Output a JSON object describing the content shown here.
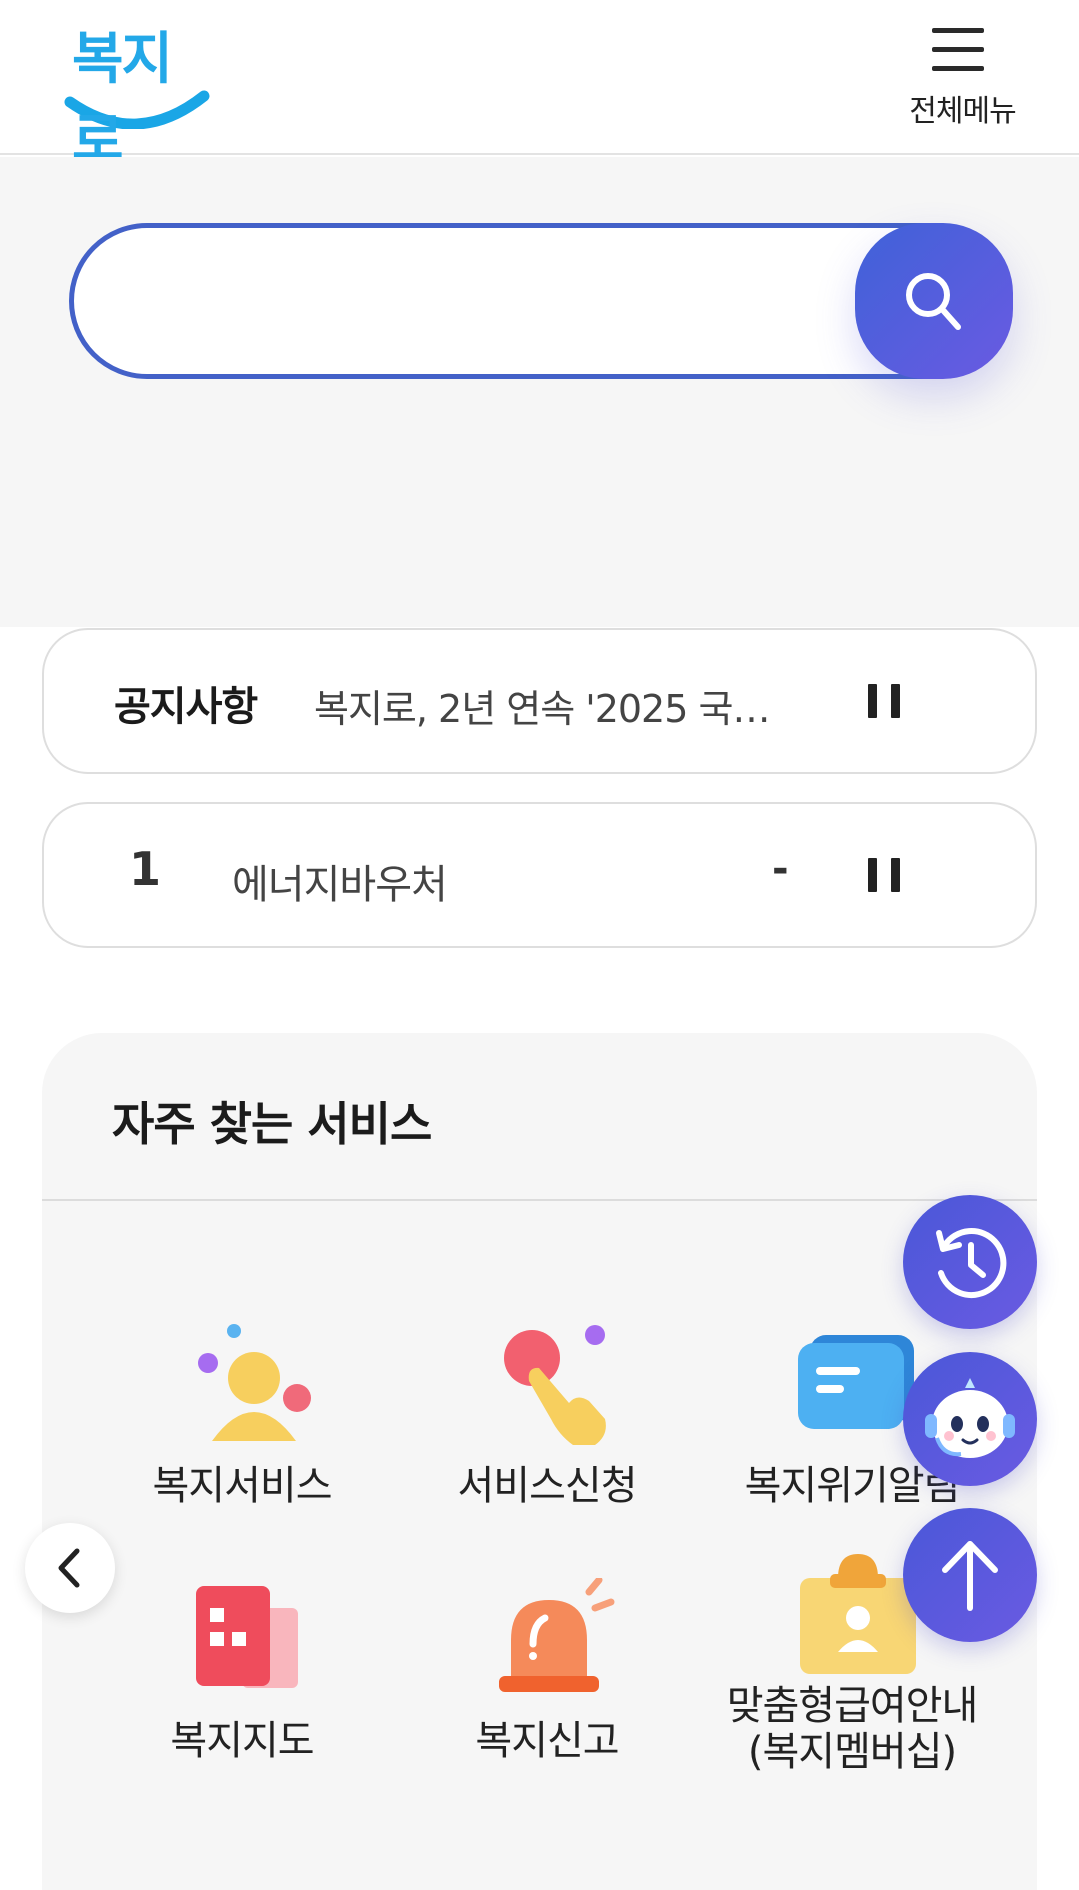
{
  "header": {
    "logo_text": "복지로",
    "menu_label": "전체메뉴"
  },
  "search": {
    "placeholder": ""
  },
  "notice": {
    "title": "공지사항",
    "text": "복지로, 2년 연속 '2025 국…"
  },
  "ranking": {
    "rank": "1",
    "keyword": "에너지바우처",
    "change": "-"
  },
  "services": {
    "title": "자주 찾는 서비스",
    "items": [
      {
        "label": "복지서비스",
        "icon": "person-icon"
      },
      {
        "label": "서비스신청",
        "icon": "hand-tap-icon"
      },
      {
        "label": "복지위기알림",
        "icon": "chat-bubble-icon"
      },
      {
        "label": "복지지도",
        "icon": "map-building-icon"
      },
      {
        "label": "복지신고",
        "icon": "siren-icon"
      },
      {
        "label": "맞춤형급여안내\n(복지멤버십)",
        "label_line1": "맞춤형급여안내",
        "label_line2": "(복지멤버십)",
        "icon": "clipboard-person-icon"
      }
    ]
  },
  "floating": {
    "history": "history-icon",
    "chatbot": "chatbot-icon",
    "top": "arrow-up-icon"
  },
  "colors": {
    "brand_blue": "#4361c8",
    "brand_purple": "#6a5ae2",
    "logo_blue": "#23a8e8"
  }
}
